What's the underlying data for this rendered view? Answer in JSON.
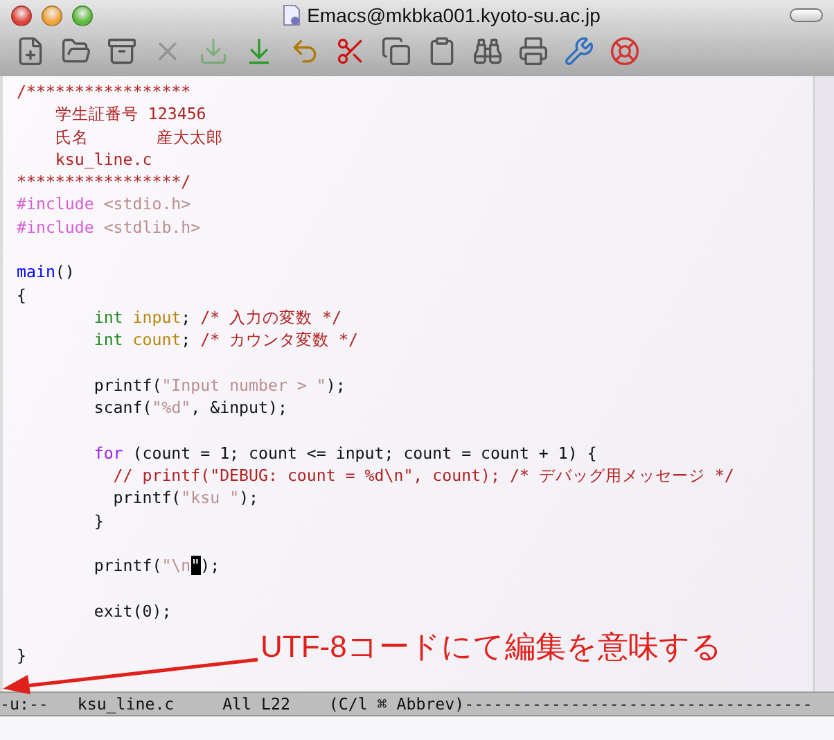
{
  "window": {
    "title": "Emacs@mkbka001.kyoto-su.ac.jp"
  },
  "toolbar": [
    {
      "kind": "new",
      "disabled": false
    },
    {
      "kind": "open",
      "disabled": false
    },
    {
      "kind": "save",
      "disabled": false
    },
    {
      "kind": "close",
      "disabled": true
    },
    {
      "kind": "download",
      "disabled": true
    },
    {
      "kind": "saveas",
      "disabled": false
    },
    {
      "kind": "undo",
      "disabled": false
    },
    {
      "kind": "cut",
      "disabled": false
    },
    {
      "kind": "copy",
      "disabled": false
    },
    {
      "kind": "paste",
      "disabled": false
    },
    {
      "kind": "search",
      "disabled": false
    },
    {
      "kind": "print",
      "disabled": false
    },
    {
      "kind": "tools",
      "disabled": false
    },
    {
      "kind": "help",
      "disabled": false
    }
  ],
  "editor": {
    "lines": [
      {
        "kind": "code",
        "segments": [
          {
            "kind": "comment",
            "text": "/*****************"
          }
        ]
      },
      {
        "kind": "code",
        "segments": [
          {
            "kind": "comment",
            "text": "    学生証番号 123456"
          }
        ]
      },
      {
        "kind": "code",
        "segments": [
          {
            "kind": "comment",
            "text": "    氏名       産大太郎"
          }
        ]
      },
      {
        "kind": "code",
        "segments": [
          {
            "kind": "comment",
            "text": "    ksu_line.c"
          }
        ]
      },
      {
        "kind": "code",
        "segments": [
          {
            "kind": "comment",
            "text": "*****************/"
          }
        ]
      },
      {
        "kind": "code",
        "segments": [
          {
            "kind": "preproc",
            "text": "#include"
          },
          {
            "kind": "string",
            "text": " <stdio.h>"
          }
        ]
      },
      {
        "kind": "code",
        "segments": [
          {
            "kind": "preproc",
            "text": "#include"
          },
          {
            "kind": "string",
            "text": " <stdlib.h>"
          }
        ]
      },
      {
        "kind": "blank"
      },
      {
        "kind": "code",
        "segments": [
          {
            "kind": "function",
            "text": "main"
          },
          {
            "kind": "plain",
            "text": "()"
          }
        ]
      },
      {
        "kind": "code",
        "segments": [
          {
            "kind": "plain",
            "text": "{"
          }
        ]
      },
      {
        "kind": "code",
        "segments": [
          {
            "kind": "type",
            "text": "        int"
          },
          {
            "kind": "variable",
            "text": " input"
          },
          {
            "kind": "plain",
            "text": ";"
          },
          {
            "kind": "comment",
            "text": " /* 入力の変数 */"
          }
        ]
      },
      {
        "kind": "code",
        "segments": [
          {
            "kind": "type",
            "text": "        int"
          },
          {
            "kind": "variable",
            "text": " count"
          },
          {
            "kind": "plain",
            "text": ";"
          },
          {
            "kind": "comment",
            "text": " /* カウンタ変数 */"
          }
        ]
      },
      {
        "kind": "blank"
      },
      {
        "kind": "code",
        "segments": [
          {
            "kind": "plain",
            "text": "        printf("
          },
          {
            "kind": "string",
            "text": "\"Input number > \""
          },
          {
            "kind": "plain",
            "text": ");"
          }
        ]
      },
      {
        "kind": "code",
        "segments": [
          {
            "kind": "plain",
            "text": "        scanf("
          },
          {
            "kind": "string",
            "text": "\"%d\""
          },
          {
            "kind": "plain",
            "text": ", &input);"
          }
        ]
      },
      {
        "kind": "blank"
      },
      {
        "kind": "code",
        "segments": [
          {
            "kind": "keyword",
            "text": "        for"
          },
          {
            "kind": "plain",
            "text": " (count = 1; count <= input; count = count + 1) {"
          }
        ]
      },
      {
        "kind": "code",
        "segments": [
          {
            "kind": "comment",
            "text": "          // printf(\"DEBUG: count = %d\\n\", count); /* デバッグ用メッセージ */"
          }
        ]
      },
      {
        "kind": "code",
        "segments": [
          {
            "kind": "plain",
            "text": "          printf("
          },
          {
            "kind": "string",
            "text": "\"ksu \""
          },
          {
            "kind": "plain",
            "text": ");"
          }
        ]
      },
      {
        "kind": "code",
        "segments": [
          {
            "kind": "plain",
            "text": "        }"
          }
        ]
      },
      {
        "kind": "blank"
      },
      {
        "kind": "code",
        "segments": [
          {
            "kind": "plain",
            "text": "        printf("
          },
          {
            "kind": "string",
            "text": "\"\\n"
          },
          {
            "kind": "cursor",
            "text": "\""
          },
          {
            "kind": "plain",
            "text": ");"
          }
        ]
      },
      {
        "kind": "blank"
      },
      {
        "kind": "code",
        "segments": [
          {
            "kind": "plain",
            "text": "        exit(0);"
          }
        ]
      },
      {
        "kind": "blank"
      },
      {
        "kind": "code",
        "segments": [
          {
            "kind": "plain",
            "text": "}"
          }
        ]
      }
    ]
  },
  "mode_line": {
    "status": "-u:--",
    "buffer": "ksu_line.c",
    "position": "All L22",
    "modes": "(C/l ⌘ Abbrev)",
    "fill": "------------------------------------"
  },
  "annotation": {
    "text": "UTF-8コードにて編集を意味する"
  }
}
